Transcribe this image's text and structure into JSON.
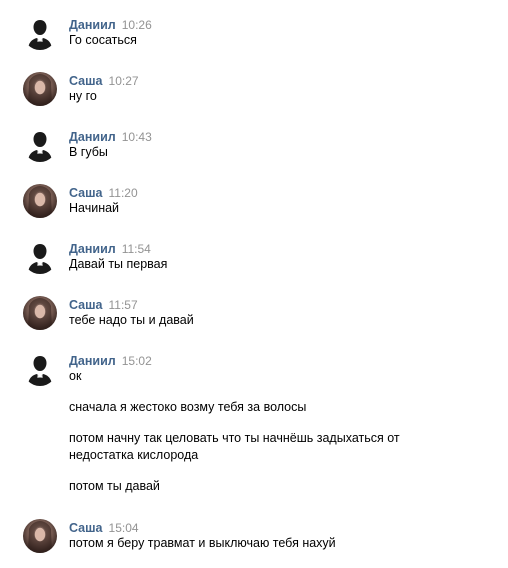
{
  "messages": [
    {
      "author": "Даниил",
      "time": "10:26",
      "lines": [
        "Го сосаться"
      ]
    },
    {
      "author": "Саша",
      "time": "10:27",
      "lines": [
        "ну го"
      ]
    },
    {
      "author": "Даниил",
      "time": "10:43",
      "lines": [
        "В губы"
      ]
    },
    {
      "author": "Саша",
      "time": "11:20",
      "lines": [
        "Начинай"
      ]
    },
    {
      "author": "Даниил",
      "time": "11:54",
      "lines": [
        "Давай ты первая"
      ]
    },
    {
      "author": "Саша",
      "time": "11:57",
      "lines": [
        "тебе надо ты и давай"
      ]
    },
    {
      "author": "Даниил",
      "time": "15:02",
      "lines": [
        "ок",
        "сначала я жестоко возму тебя за волосы",
        "потом начну так целовать что ты начнёшь задыхаться от",
        "недостатка кислорода",
        "потом ты давай"
      ]
    },
    {
      "author": "Саша",
      "time": "15:04",
      "lines": [
        "потом я беру травмат и выключаю тебя нахуй"
      ]
    }
  ],
  "colors": {
    "author": "#42648b",
    "time": "#939393",
    "text": "#000000"
  }
}
